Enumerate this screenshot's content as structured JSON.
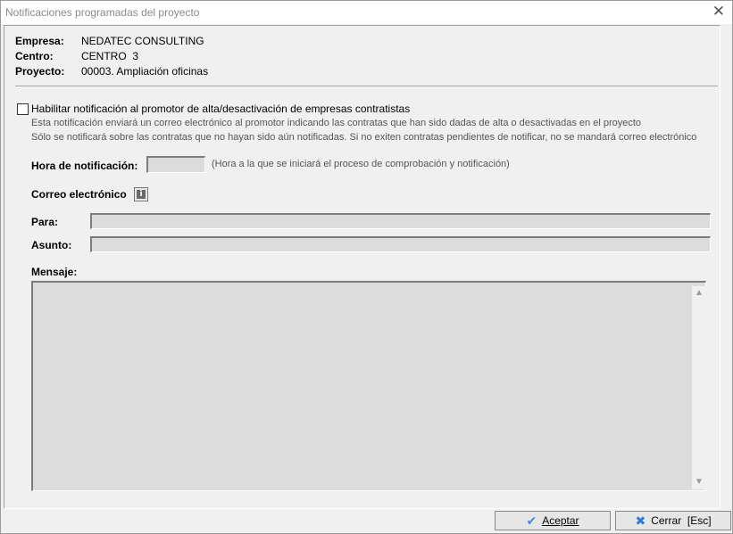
{
  "window": {
    "title": "Notificaciones programadas del proyecto",
    "close_glyph": "✕"
  },
  "header": {
    "empresa_label": "Empresa:",
    "empresa_value": "NEDATEC CONSULTING",
    "centro_label": "Centro:",
    "centro_value": "CENTRO  3",
    "proyecto_label": "Proyecto:",
    "proyecto_value": "00003. Ampliación oficinas"
  },
  "notification": {
    "checkbox_label": "Habilitar notificación al promotor de alta/desactivación de empresas contratistas",
    "checked": false,
    "desc_line1": "Esta notificación enviará un correo electrónico al promotor indicando las contratas que han sido dadas de alta o desactivadas en el proyecto",
    "desc_line2": "Sólo se notificará sobre las contratas que no hayan sido aún notificadas. Si no exiten contratas pendientes de notificar, no se mandará correo electrónico",
    "hora_label": "Hora de notificación:",
    "hora_value": "",
    "hora_hint": "(Hora a la que se iniciará el proceso de comprobación y notificación)"
  },
  "email": {
    "section_label": "Correo electrónico",
    "info_icon": "info-icon",
    "para_label": "Para:",
    "para_value": "",
    "asunto_label": "Asunto:",
    "asunto_value": "",
    "mensaje_label": "Mensaje:",
    "mensaje_value": ""
  },
  "footer": {
    "accept_label": "Aceptar",
    "accept_icon": "checkmark-icon",
    "close_label": "Cerrar  [Esc]",
    "close_icon": "x-icon"
  },
  "colors": {
    "field_bg": "#dcdcdc",
    "window_bg": "#f0f0f0",
    "accent_blue": "#2e7ad1"
  }
}
